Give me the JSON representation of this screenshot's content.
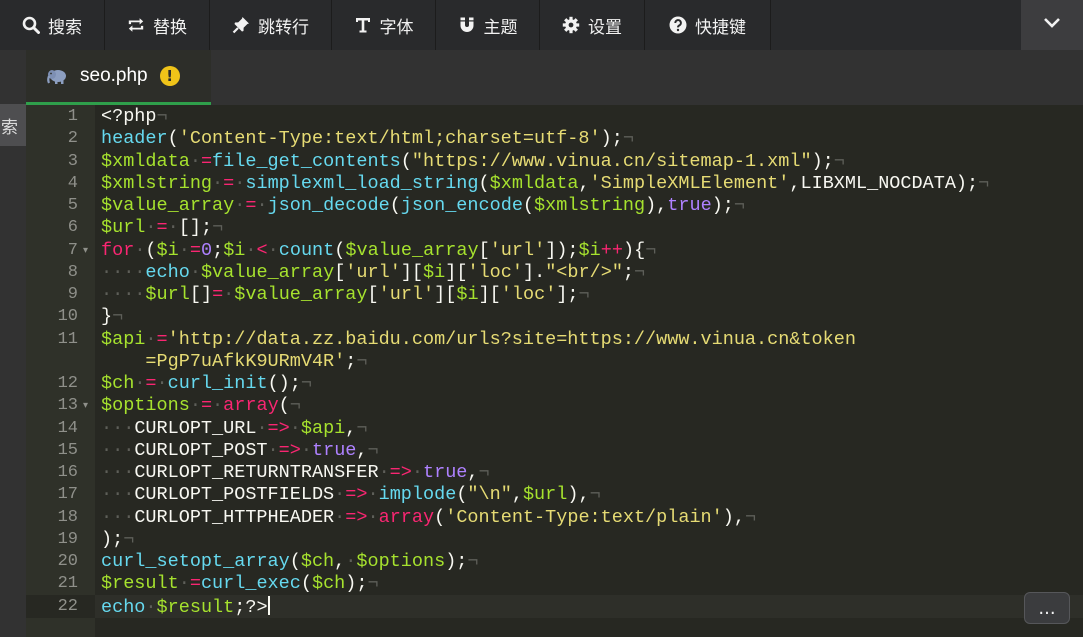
{
  "toolbar": {
    "buttons": [
      {
        "label": "搜索",
        "icon": "search-icon"
      },
      {
        "label": "替换",
        "icon": "replace-icon"
      },
      {
        "label": "跳转行",
        "icon": "pin-icon"
      },
      {
        "label": "字体",
        "icon": "text-icon"
      },
      {
        "label": "主题",
        "icon": "magnet-icon"
      },
      {
        "label": "设置",
        "icon": "gear-icon"
      },
      {
        "label": "快捷键",
        "icon": "help-icon"
      }
    ],
    "collapse_icon": "chevron-down-icon"
  },
  "side_panel": {
    "partial_label": "索"
  },
  "tab": {
    "title": "seo.php",
    "icon": "elephant-icon",
    "warning": "!"
  },
  "more_button": {
    "label": "..."
  },
  "colors": {
    "background": "#272822",
    "gutter": "#2f3129",
    "tab_underline": "#2f9f4b",
    "warning": "#f0c419",
    "string": "#e6db74",
    "function": "#66d9ef",
    "variable": "#a6e22e",
    "keyword": "#f92672",
    "constant": "#ae81ff"
  },
  "editor": {
    "current_line": 22,
    "folded_lines": [
      7,
      13
    ],
    "lines": [
      {
        "n": "1",
        "tokens": [
          [
            "plain",
            "<?php"
          ],
          [
            "eol",
            "¬"
          ]
        ]
      },
      {
        "n": "2",
        "tokens": [
          [
            "fn",
            "header"
          ],
          [
            "plain",
            "("
          ],
          [
            "str",
            "'Content-Type:text/html;charset=utf-8'"
          ],
          [
            "plain",
            ");"
          ],
          [
            "eol",
            "¬"
          ]
        ]
      },
      {
        "n": "3",
        "tokens": [
          [
            "var",
            "$xmldata"
          ],
          [
            "ws",
            "·"
          ],
          [
            "op",
            "="
          ],
          [
            "fn",
            "file_get_contents"
          ],
          [
            "plain",
            "("
          ],
          [
            "str",
            "\"https://www.vinua.cn/sitemap-1.xml\""
          ],
          [
            "plain",
            ");"
          ],
          [
            "eol",
            "¬"
          ]
        ]
      },
      {
        "n": "4",
        "tokens": [
          [
            "var",
            "$xmlstring"
          ],
          [
            "ws",
            "·"
          ],
          [
            "op",
            "="
          ],
          [
            "ws",
            "·"
          ],
          [
            "fn",
            "simplexml_load_string"
          ],
          [
            "plain",
            "("
          ],
          [
            "var",
            "$xmldata"
          ],
          [
            "plain",
            ","
          ],
          [
            "str",
            "'SimpleXMLElement'"
          ],
          [
            "plain",
            ",LIBXML_NOCDATA);"
          ],
          [
            "eol",
            "¬"
          ]
        ]
      },
      {
        "n": "5",
        "tokens": [
          [
            "var",
            "$value_array"
          ],
          [
            "ws",
            "·"
          ],
          [
            "op",
            "="
          ],
          [
            "ws",
            "·"
          ],
          [
            "fn",
            "json_decode"
          ],
          [
            "plain",
            "("
          ],
          [
            "fn",
            "json_encode"
          ],
          [
            "plain",
            "("
          ],
          [
            "var",
            "$xmlstring"
          ],
          [
            "plain",
            "),"
          ],
          [
            "num",
            "true"
          ],
          [
            "plain",
            ");"
          ],
          [
            "eol",
            "¬"
          ]
        ]
      },
      {
        "n": "6",
        "tokens": [
          [
            "var",
            "$url"
          ],
          [
            "ws",
            "·"
          ],
          [
            "op",
            "="
          ],
          [
            "ws",
            "·"
          ],
          [
            "plain",
            "[];"
          ],
          [
            "eol",
            "¬"
          ]
        ]
      },
      {
        "n": "7",
        "tokens": [
          [
            "kw",
            "for"
          ],
          [
            "ws",
            "·"
          ],
          [
            "plain",
            "("
          ],
          [
            "var",
            "$i"
          ],
          [
            "ws",
            "·"
          ],
          [
            "op",
            "="
          ],
          [
            "num",
            "0"
          ],
          [
            "plain",
            ";"
          ],
          [
            "var",
            "$i"
          ],
          [
            "ws",
            "·"
          ],
          [
            "op",
            "<"
          ],
          [
            "ws",
            "·"
          ],
          [
            "fn",
            "count"
          ],
          [
            "plain",
            "("
          ],
          [
            "var",
            "$value_array"
          ],
          [
            "plain",
            "["
          ],
          [
            "str",
            "'url'"
          ],
          [
            "plain",
            "]);"
          ],
          [
            "var",
            "$i"
          ],
          [
            "op",
            "++"
          ],
          [
            "plain",
            "){"
          ],
          [
            "eol",
            "¬"
          ]
        ]
      },
      {
        "n": "8",
        "tokens": [
          [
            "ws",
            "····"
          ],
          [
            "fn",
            "echo"
          ],
          [
            "ws",
            "·"
          ],
          [
            "var",
            "$value_array"
          ],
          [
            "plain",
            "["
          ],
          [
            "str",
            "'url'"
          ],
          [
            "plain",
            "]["
          ],
          [
            "var",
            "$i"
          ],
          [
            "plain",
            "]["
          ],
          [
            "str",
            "'loc'"
          ],
          [
            "plain",
            "]."
          ],
          [
            "str",
            "\"<br/>\""
          ],
          [
            "plain",
            ";"
          ],
          [
            "eol",
            "¬"
          ]
        ]
      },
      {
        "n": "9",
        "tokens": [
          [
            "ws",
            "····"
          ],
          [
            "var",
            "$url"
          ],
          [
            "plain",
            "[]"
          ],
          [
            "op",
            "="
          ],
          [
            "ws",
            "·"
          ],
          [
            "var",
            "$value_array"
          ],
          [
            "plain",
            "["
          ],
          [
            "str",
            "'url'"
          ],
          [
            "plain",
            "]["
          ],
          [
            "var",
            "$i"
          ],
          [
            "plain",
            "]["
          ],
          [
            "str",
            "'loc'"
          ],
          [
            "plain",
            "];"
          ],
          [
            "eol",
            "¬"
          ]
        ]
      },
      {
        "n": "10",
        "tokens": [
          [
            "plain",
            "}"
          ],
          [
            "eol",
            "¬"
          ]
        ]
      },
      {
        "n": "11",
        "tokens": [
          [
            "var",
            "$api"
          ],
          [
            "ws",
            "·"
          ],
          [
            "op",
            "="
          ],
          [
            "str",
            "'http://data.zz.baidu.com/urls?site=https://www.vinua.cn&token"
          ]
        ]
      },
      {
        "n": "",
        "tokens": [
          [
            "ws",
            "    "
          ],
          [
            "str",
            "=PgP7uAfkK9URmV4R'"
          ],
          [
            "plain",
            ";"
          ],
          [
            "eol",
            "¬"
          ]
        ]
      },
      {
        "n": "12",
        "tokens": [
          [
            "var",
            "$ch"
          ],
          [
            "ws",
            "·"
          ],
          [
            "op",
            "="
          ],
          [
            "ws",
            "·"
          ],
          [
            "fn",
            "curl_init"
          ],
          [
            "plain",
            "();"
          ],
          [
            "eol",
            "¬"
          ]
        ]
      },
      {
        "n": "13",
        "tokens": [
          [
            "var",
            "$options"
          ],
          [
            "ws",
            "·"
          ],
          [
            "op",
            "="
          ],
          [
            "ws",
            "·"
          ],
          [
            "kw",
            "array"
          ],
          [
            "plain",
            "("
          ],
          [
            "eol",
            "¬"
          ]
        ]
      },
      {
        "n": "14",
        "tokens": [
          [
            "ws",
            "···"
          ],
          [
            "plain",
            "CURLOPT_URL"
          ],
          [
            "ws",
            "·"
          ],
          [
            "op",
            "=>"
          ],
          [
            "ws",
            "·"
          ],
          [
            "var",
            "$api"
          ],
          [
            "plain",
            ","
          ],
          [
            "eol",
            "¬"
          ]
        ]
      },
      {
        "n": "15",
        "tokens": [
          [
            "ws",
            "···"
          ],
          [
            "plain",
            "CURLOPT_POST"
          ],
          [
            "ws",
            "·"
          ],
          [
            "op",
            "=>"
          ],
          [
            "ws",
            "·"
          ],
          [
            "num",
            "true"
          ],
          [
            "plain",
            ","
          ],
          [
            "eol",
            "¬"
          ]
        ]
      },
      {
        "n": "16",
        "tokens": [
          [
            "ws",
            "···"
          ],
          [
            "plain",
            "CURLOPT_RETURNTRANSFER"
          ],
          [
            "ws",
            "·"
          ],
          [
            "op",
            "=>"
          ],
          [
            "ws",
            "·"
          ],
          [
            "num",
            "true"
          ],
          [
            "plain",
            ","
          ],
          [
            "eol",
            "¬"
          ]
        ]
      },
      {
        "n": "17",
        "tokens": [
          [
            "ws",
            "···"
          ],
          [
            "plain",
            "CURLOPT_POSTFIELDS"
          ],
          [
            "ws",
            "·"
          ],
          [
            "op",
            "=>"
          ],
          [
            "ws",
            "·"
          ],
          [
            "fn",
            "implode"
          ],
          [
            "plain",
            "("
          ],
          [
            "str",
            "\"\\n\""
          ],
          [
            "plain",
            ","
          ],
          [
            "var",
            "$url"
          ],
          [
            "plain",
            "),"
          ],
          [
            "eol",
            "¬"
          ]
        ]
      },
      {
        "n": "18",
        "tokens": [
          [
            "ws",
            "···"
          ],
          [
            "plain",
            "CURLOPT_HTTPHEADER"
          ],
          [
            "ws",
            "·"
          ],
          [
            "op",
            "=>"
          ],
          [
            "ws",
            "·"
          ],
          [
            "kw",
            "array"
          ],
          [
            "plain",
            "("
          ],
          [
            "str",
            "'Content-Type:text/plain'"
          ],
          [
            "plain",
            "),"
          ],
          [
            "eol",
            "¬"
          ]
        ]
      },
      {
        "n": "19",
        "tokens": [
          [
            "plain",
            ");"
          ],
          [
            "eol",
            "¬"
          ]
        ]
      },
      {
        "n": "20",
        "tokens": [
          [
            "fn",
            "curl_setopt_array"
          ],
          [
            "plain",
            "("
          ],
          [
            "var",
            "$ch"
          ],
          [
            "plain",
            ","
          ],
          [
            "ws",
            "·"
          ],
          [
            "var",
            "$options"
          ],
          [
            "plain",
            ");"
          ],
          [
            "eol",
            "¬"
          ]
        ]
      },
      {
        "n": "21",
        "tokens": [
          [
            "var",
            "$result"
          ],
          [
            "ws",
            "·"
          ],
          [
            "op",
            "="
          ],
          [
            "fn",
            "curl_exec"
          ],
          [
            "plain",
            "("
          ],
          [
            "var",
            "$ch"
          ],
          [
            "plain",
            ");"
          ],
          [
            "eol",
            "¬"
          ]
        ]
      },
      {
        "n": "22",
        "tokens": [
          [
            "fn",
            "echo"
          ],
          [
            "ws",
            "·"
          ],
          [
            "var",
            "$result"
          ],
          [
            "plain",
            ";?>"
          ]
        ]
      }
    ]
  }
}
